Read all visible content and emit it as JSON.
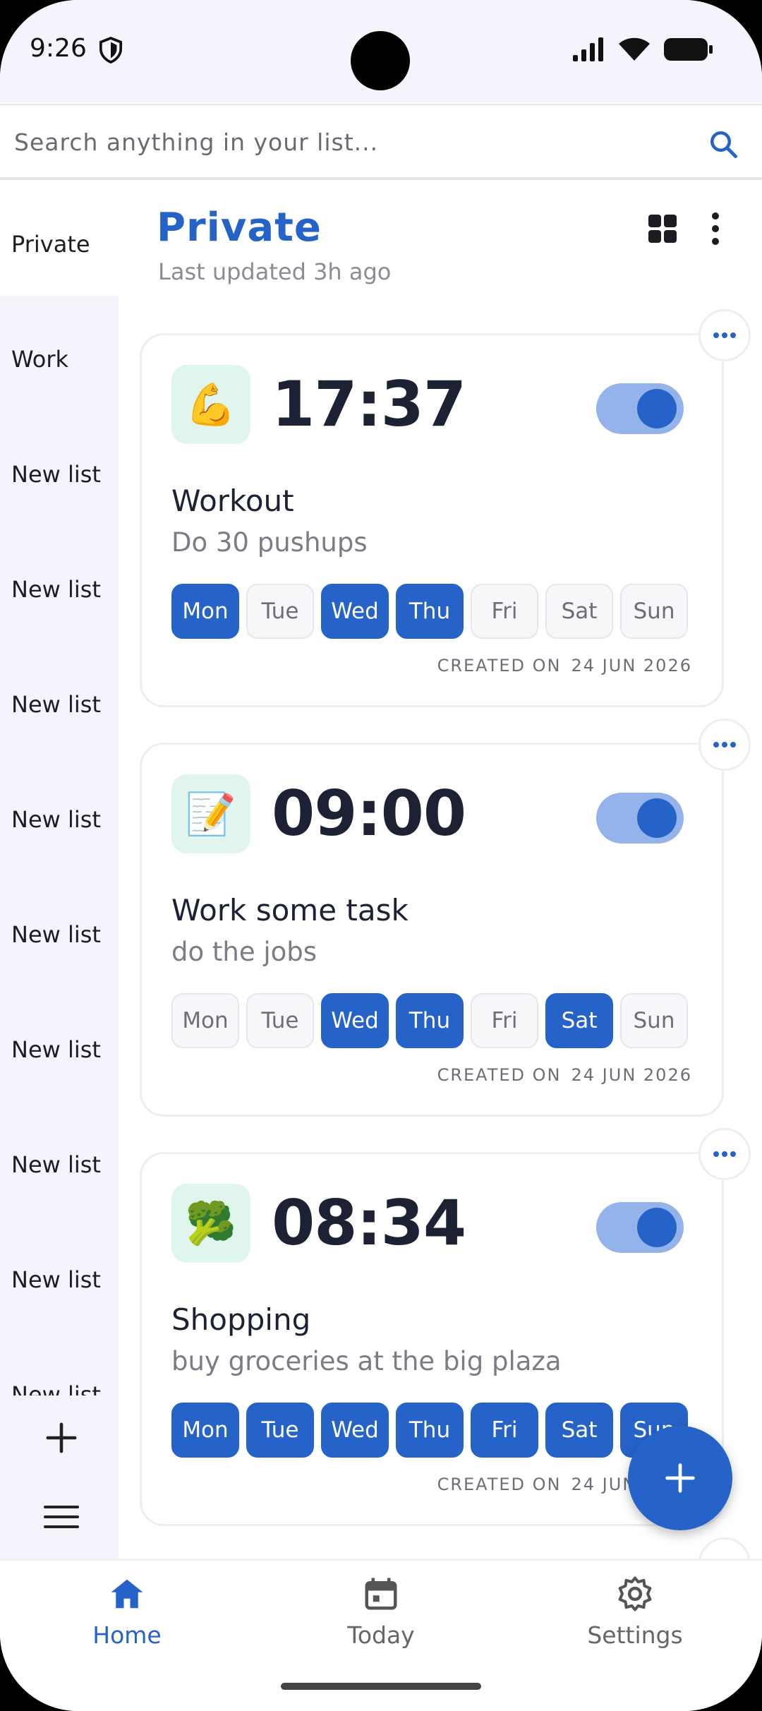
{
  "status_bar": {
    "time": "9:26"
  },
  "search": {
    "placeholder": "Search anything in your list..."
  },
  "sidebar": {
    "items": [
      "Private",
      "Work",
      "New list",
      "New list",
      "New list",
      "New list",
      "New list",
      "New list",
      "New list",
      "New list",
      "New list"
    ],
    "active_index": 0
  },
  "header": {
    "title": "Private",
    "subtitle": "Last updated 3h ago"
  },
  "day_labels": [
    "Mon",
    "Tue",
    "Wed",
    "Thu",
    "Fri",
    "Sat",
    "Sun"
  ],
  "cards": [
    {
      "emoji": "💪",
      "time": "17:37",
      "title": "Workout",
      "description": "Do 30 pushups",
      "enabled": true,
      "active_days": [
        true,
        false,
        true,
        true,
        false,
        false,
        false
      ],
      "created_label": "CREATED ON",
      "created_date": "24 JUN 2026"
    },
    {
      "emoji": "📝",
      "time": "09:00",
      "title": "Work some task",
      "description": "do the jobs",
      "enabled": true,
      "active_days": [
        false,
        false,
        true,
        true,
        false,
        true,
        false
      ],
      "created_label": "CREATED ON",
      "created_date": "24 JUN 2026"
    },
    {
      "emoji": "🥦",
      "time": "08:34",
      "title": "Shopping",
      "description": "buy groceries at the big plaza",
      "enabled": true,
      "active_days": [
        true,
        true,
        true,
        true,
        true,
        true,
        true
      ],
      "created_label": "CREATED ON",
      "created_date": "24 JUN 2026"
    }
  ],
  "bottom_nav": {
    "items": [
      {
        "label": "Home",
        "icon": "home-icon",
        "active": true
      },
      {
        "label": "Today",
        "icon": "calendar-icon",
        "active": false
      },
      {
        "label": "Settings",
        "icon": "gear-icon",
        "active": false
      }
    ]
  },
  "colors": {
    "accent": "#2563c9",
    "toggle_track": "#93b3ea",
    "emoji_bg": "#dff5ee",
    "sidebar_bg": "#f4f5fc"
  }
}
